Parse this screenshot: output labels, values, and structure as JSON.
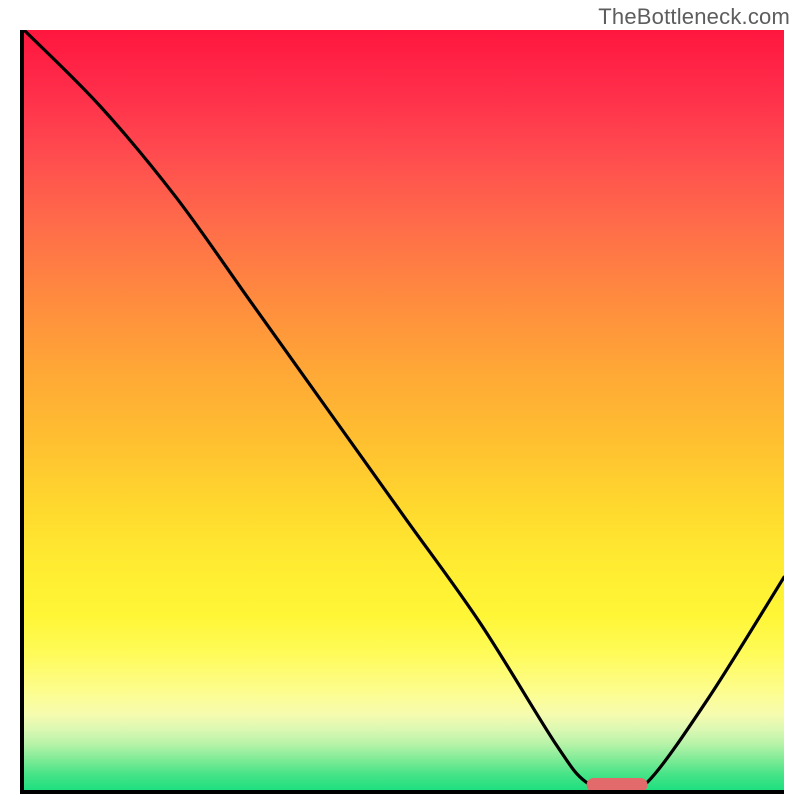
{
  "watermark": "TheBottleneck.com",
  "chart_data": {
    "type": "line",
    "title": "",
    "xlabel": "",
    "ylabel": "",
    "xlim": [
      0,
      100
    ],
    "ylim": [
      0,
      100
    ],
    "x": [
      0,
      10,
      20,
      30,
      40,
      50,
      60,
      70,
      74,
      78,
      82,
      90,
      100
    ],
    "values": [
      100,
      90,
      78,
      64,
      50,
      36,
      22,
      6,
      1,
      0,
      1,
      12,
      28
    ],
    "marker": {
      "x_center": 78,
      "y": 0,
      "width": 8
    },
    "gradient_note": "vertical rainbow background red-top to green-bottom"
  }
}
